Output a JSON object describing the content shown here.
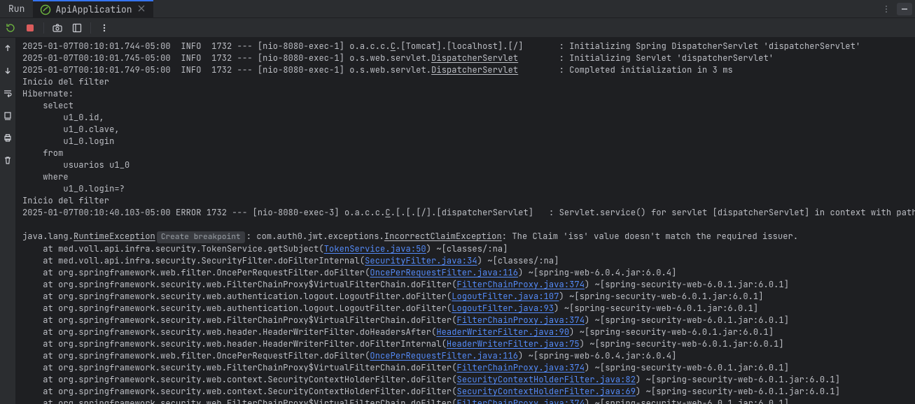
{
  "panel": {
    "label": "Run"
  },
  "tab": {
    "name": "ApiApplication"
  },
  "icons": {
    "rerun": "rerun-icon",
    "stop": "stop-icon",
    "camera": "camera-icon",
    "layout": "layout-icon",
    "more": "more-icon",
    "up": "up-arrow-icon",
    "down": "down-arrow-icon",
    "wrap": "wrap-icon",
    "print": "print-icon",
    "trash": "trash-icon",
    "close": "close-icon",
    "menu": "menu-icon",
    "hide": "hide-icon"
  },
  "hint": "Create breakpoint",
  "log_info": [
    {
      "ts": "2025-01-07T00:10:01.744-05:00",
      "lvl": "INFO",
      "pid": "1732",
      "th": "[nio-8080-exec-1]",
      "cls": "o.a.c.c.C.[Tomcat].[localhost].[/]",
      "ul": "C",
      "msg": ": Initializing Spring DispatcherServlet 'dispatcherServlet'"
    },
    {
      "ts": "2025-01-07T00:10:01.745-05:00",
      "lvl": "INFO",
      "pid": "1732",
      "th": "[nio-8080-exec-1]",
      "cls": "o.s.web.servlet.",
      "ul": "DispatcherServlet",
      "msg": ": Initializing Servlet 'dispatcherServlet'"
    },
    {
      "ts": "2025-01-07T00:10:01.749-05:00",
      "lvl": "INFO",
      "pid": "1732",
      "th": "[nio-8080-exec-1]",
      "cls": "o.s.web.servlet.",
      "ul": "DispatcherServlet",
      "msg": ": Completed initialization in 3 ms"
    }
  ],
  "plain_block": [
    "Inicio del filter",
    "Hibernate:",
    "    select",
    "        u1_0.id,",
    "        u1_0.clave,",
    "        u1_0.login",
    "    from",
    "        usuarios u1_0",
    "    where",
    "        u1_0.login=?",
    "Inicio del filter"
  ],
  "error_header": {
    "ts": "2025-01-07T00:10:40.103-05:00",
    "lvl": "ERROR",
    "pid": "1732",
    "th": "[nio-8080-exec-3]",
    "cls": "o.a.c.c.C.[.[.[/].[dispatcherServlet]",
    "ul": "C",
    "msg": ": Servlet.service() for servlet [dispatcherServlet] in context with path [] threw exception"
  },
  "exception": {
    "prefix": "java.lang.",
    "runtime": "RuntimeException",
    "mid": ": com.auth0.jwt.exceptions.",
    "claim": "IncorrectClaimException",
    "tail": ": The Claim 'iss' value doesn't match the required issuer."
  },
  "stack": [
    {
      "at": "at med.voll.api.infra.security.TokenService.getSubject(",
      "link": "TokenService.java:50",
      "suffix": ") ~[classes/:na]"
    },
    {
      "at": "at med.voll.api.infra.security.SecurityFilter.doFilterInternal(",
      "link": "SecurityFilter.java:34",
      "suffix": ") ~[classes/:na]"
    },
    {
      "at": "at org.springframework.web.filter.OncePerRequestFilter.doFilter(",
      "link": "OncePerRequestFilter.java:116",
      "suffix": ") ~[spring-web-6.0.4.jar:6.0.4]"
    },
    {
      "at": "at org.springframework.security.web.FilterChainProxy$VirtualFilterChain.doFilter(",
      "link": "FilterChainProxy.java:374",
      "suffix": ") ~[spring-security-web-6.0.1.jar:6.0.1]"
    },
    {
      "at": "at org.springframework.security.web.authentication.logout.LogoutFilter.doFilter(",
      "link": "LogoutFilter.java:107",
      "suffix": ") ~[spring-security-web-6.0.1.jar:6.0.1]"
    },
    {
      "at": "at org.springframework.security.web.authentication.logout.LogoutFilter.doFilter(",
      "link": "LogoutFilter.java:93",
      "suffix": ") ~[spring-security-web-6.0.1.jar:6.0.1]"
    },
    {
      "at": "at org.springframework.security.web.FilterChainProxy$VirtualFilterChain.doFilter(",
      "link": "FilterChainProxy.java:374",
      "suffix": ") ~[spring-security-web-6.0.1.jar:6.0.1]"
    },
    {
      "at": "at org.springframework.security.web.header.HeaderWriterFilter.doHeadersAfter(",
      "link": "HeaderWriterFilter.java:90",
      "suffix": ") ~[spring-security-web-6.0.1.jar:6.0.1]"
    },
    {
      "at": "at org.springframework.security.web.header.HeaderWriterFilter.doFilterInternal(",
      "link": "HeaderWriterFilter.java:75",
      "suffix": ") ~[spring-security-web-6.0.1.jar:6.0.1]"
    },
    {
      "at": "at org.springframework.web.filter.OncePerRequestFilter.doFilter(",
      "link": "OncePerRequestFilter.java:116",
      "suffix": ") ~[spring-web-6.0.4.jar:6.0.4]"
    },
    {
      "at": "at org.springframework.security.web.FilterChainProxy$VirtualFilterChain.doFilter(",
      "link": "FilterChainProxy.java:374",
      "suffix": ") ~[spring-security-web-6.0.1.jar:6.0.1]"
    },
    {
      "at": "at org.springframework.security.web.context.SecurityContextHolderFilter.doFilter(",
      "link": "SecurityContextHolderFilter.java:82",
      "suffix": ") ~[spring-security-web-6.0.1.jar:6.0.1]"
    },
    {
      "at": "at org.springframework.security.web.context.SecurityContextHolderFilter.doFilter(",
      "link": "SecurityContextHolderFilter.java:69",
      "suffix": ") ~[spring-security-web-6.0.1.jar:6.0.1]"
    },
    {
      "at": "at org.springframework.security.web.FilterChainProxy$VirtualFilterChain.doFilter(",
      "link": "FilterChainProxy.java:374",
      "suffix": ") ~[spring-security-web-6.0.1.jar:6.0.1]"
    }
  ]
}
